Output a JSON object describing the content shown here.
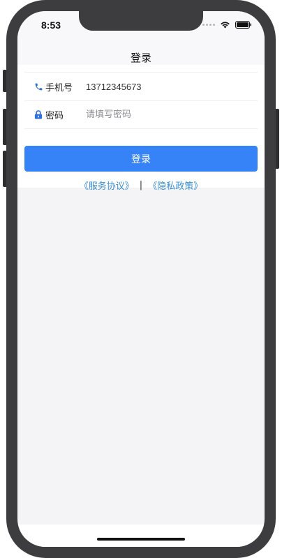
{
  "status_bar": {
    "time": "8:53"
  },
  "nav": {
    "title": "登录"
  },
  "form": {
    "phone": {
      "icon": "phone-icon",
      "label": "手机号",
      "value": "13712345673"
    },
    "password": {
      "icon": "lock-icon",
      "label": "密码",
      "placeholder": "请填写密码"
    },
    "login_button_label": "登录"
  },
  "agreements": {
    "service": "《服务协议》",
    "separator": "|",
    "privacy": "《隐私政策》"
  },
  "colors": {
    "primary": "#3583f6",
    "link": "#3a8fd0",
    "icon": "#2f6fd8"
  }
}
